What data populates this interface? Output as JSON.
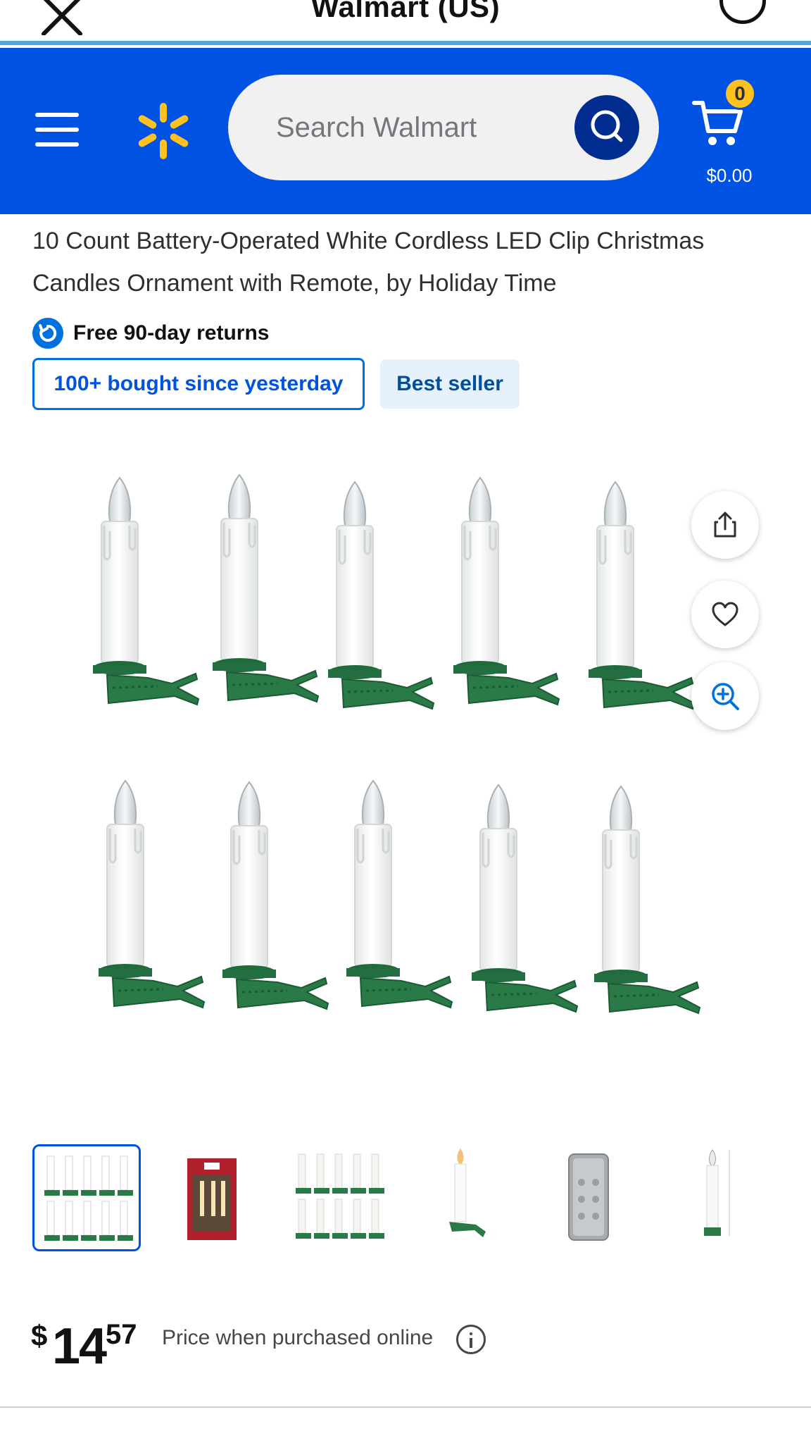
{
  "topbar": {
    "title": "Walmart (US)"
  },
  "header": {
    "search_placeholder": "Search Walmart",
    "cart_count": "0",
    "cart_total": "$0.00",
    "brand_color": "#0053e2",
    "spark_color": "#ffc220"
  },
  "product": {
    "title": "10 Count Battery-Operated White Cordless LED Clip Christmas Candles Ornament with Remote, by Holiday Time",
    "returns_label": "Free 90-day returns",
    "badge_bought": "100+ bought since yesterday",
    "badge_bestseller": "Best seller"
  },
  "actions": {
    "share_icon": "share-icon",
    "favorite_icon": "heart-icon",
    "zoom_icon": "zoom-in-icon"
  },
  "thumbnails": [
    {
      "desc": "candles-set",
      "selected": true
    },
    {
      "desc": "package",
      "selected": false
    },
    {
      "desc": "candles-set-lit",
      "selected": false
    },
    {
      "desc": "single-candle",
      "selected": false
    },
    {
      "desc": "remote",
      "selected": false
    },
    {
      "desc": "dimensions",
      "selected": false
    }
  ],
  "price": {
    "currency": "$",
    "whole": "14",
    "cents": "57",
    "note": "Price when purchased online"
  }
}
